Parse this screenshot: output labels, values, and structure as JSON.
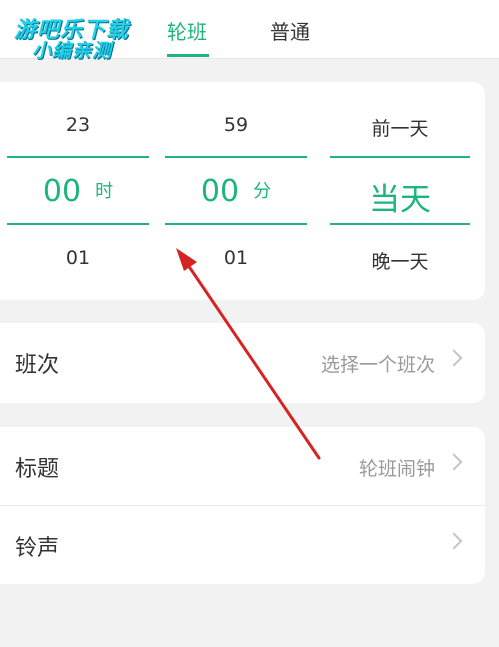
{
  "watermark": {
    "line1": "游吧乐下载",
    "line2": "小编亲测"
  },
  "tabs": [
    {
      "label": "轮班",
      "active": true
    },
    {
      "label": "普通",
      "active": false
    }
  ],
  "picker": {
    "hour": {
      "above": "23",
      "selected": "00",
      "unit": "时",
      "below": "01"
    },
    "minute": {
      "above": "59",
      "selected": "00",
      "unit": "分",
      "below": "01"
    },
    "day": {
      "above": "前一天",
      "selected": "当天",
      "below": "晚一天"
    }
  },
  "settings": {
    "shift": {
      "label": "班次",
      "value": "选择一个班次"
    },
    "title": {
      "label": "标题",
      "value": "轮班闹钟"
    },
    "ringtone": {
      "label": "铃声",
      "value": ""
    }
  },
  "colors": {
    "accent": "#1db57e",
    "annotation_arrow": "#d62424"
  }
}
